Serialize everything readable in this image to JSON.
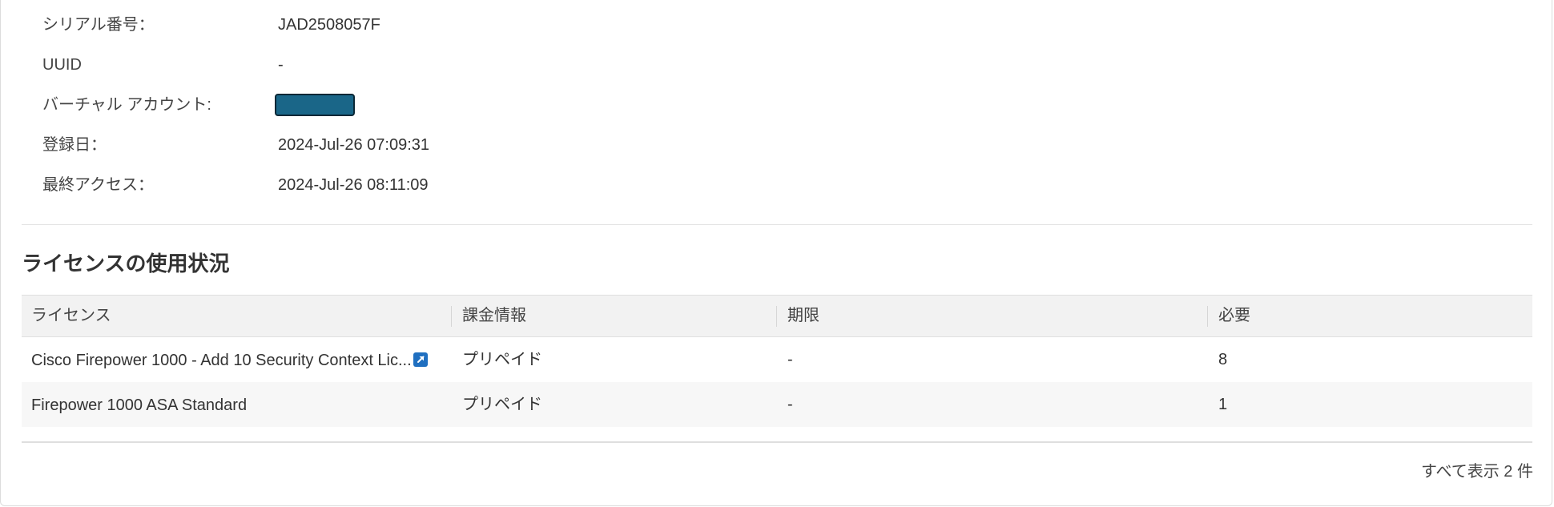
{
  "details": {
    "serial": {
      "label": "シリアル番号：",
      "value": "JAD2508057F"
    },
    "uuid": {
      "label": "UUID",
      "value": "-"
    },
    "virtual_account": {
      "label": "バーチャル アカウント:"
    },
    "registered": {
      "label": "登録日：",
      "value": "2024-Jul-26 07:09:31"
    },
    "last_access": {
      "label": "最終アクセス：",
      "value": "2024-Jul-26 08:11:09"
    }
  },
  "license_usage": {
    "title": "ライセンスの使用状況",
    "columns": [
      "ライセンス",
      "課金情報",
      "期限",
      "必要"
    ],
    "rows": [
      {
        "license": "Cisco Firepower 1000 - Add 10 Security Context Lic...",
        "billing": "プリペイド",
        "expiry": "-",
        "required": "8"
      },
      {
        "license": "Firepower 1000 ASA Standard",
        "billing": "プリペイド",
        "expiry": "-",
        "required": "1"
      }
    ],
    "footer": "すべて表示 2 件"
  },
  "colors": {
    "redacted_fill": "#1a6688",
    "link_icon": "#1f6fc0",
    "header_bg": "#f2f2f2"
  },
  "icons": {
    "external_link": "external-link-icon"
  }
}
